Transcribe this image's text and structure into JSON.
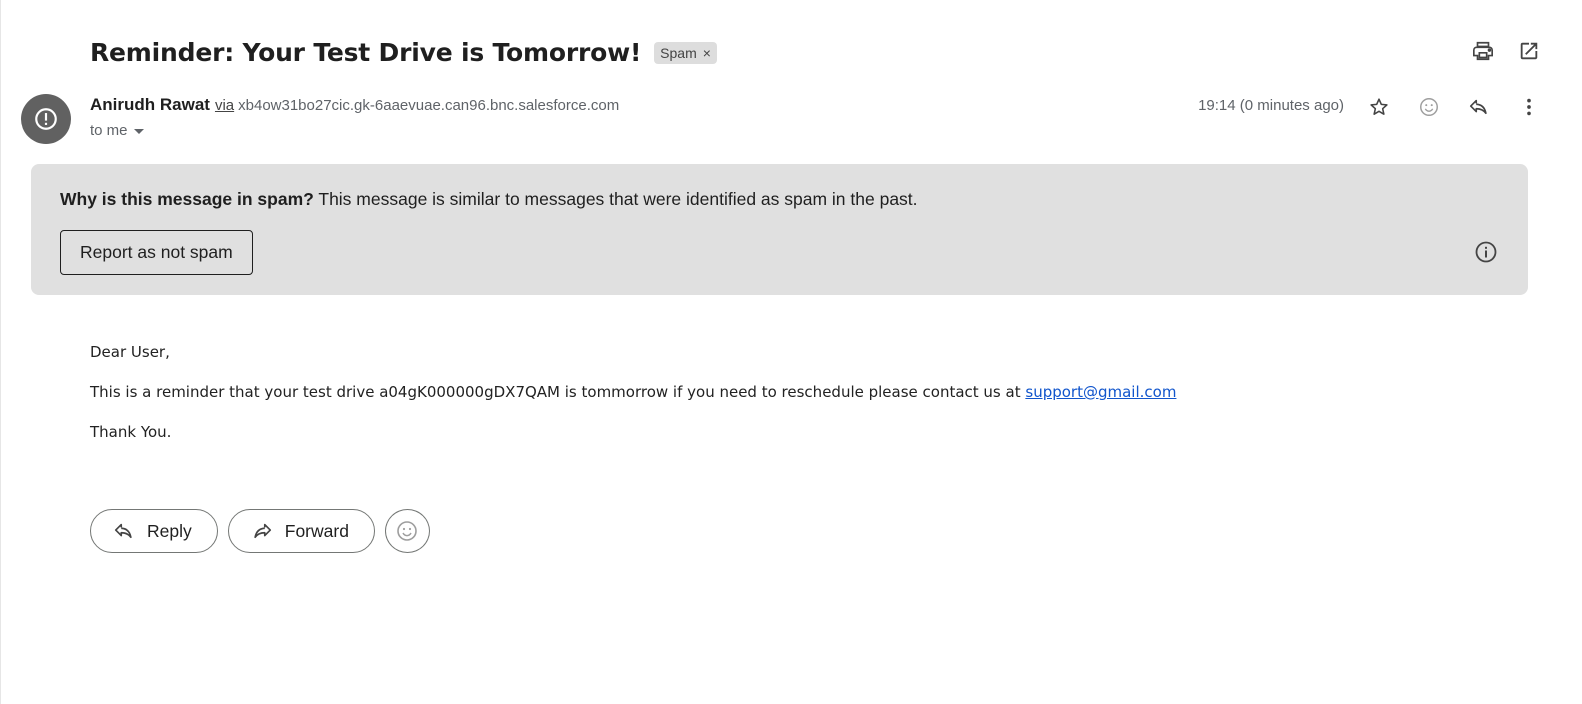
{
  "email": {
    "subject": "Reminder: Your Test Drive is Tomorrow!",
    "label_chip": "Spam",
    "label_remove": "×",
    "sender_name": "Anirudh Rawat",
    "via_label": "via",
    "via_domain": "xb4ow31bo27cic.gk-6aaevuae.can96.bnc.salesforce.com",
    "recipient": "to me",
    "timestamp": "19:14 (0 minutes ago)"
  },
  "spam_banner": {
    "question": "Why is this message in spam?",
    "explanation": " This message is similar to messages that were identified as spam in the past.",
    "button_label": "Report as not spam"
  },
  "body": {
    "greeting": "Dear User,",
    "line_prefix": "This is a reminder that your test drive a04gK000000gDX7QAM is tommorrow if you need to reschedule please contact us at ",
    "link_text": "support@gmail.com",
    "closing": "Thank You."
  },
  "actions": {
    "reply_label": "Reply",
    "forward_label": "Forward"
  },
  "icons": {
    "top": [
      "print-icon",
      "open-in-new-window-icon"
    ],
    "message": [
      "star-icon",
      "emoji-reaction-icon",
      "reply-icon",
      "more-vert-icon"
    ],
    "avatar": "warning-icon",
    "info": "info-icon"
  },
  "colors": {
    "banner_bg": "#e0e0e0",
    "avatar_bg": "#616161",
    "link": "#1155cc"
  }
}
